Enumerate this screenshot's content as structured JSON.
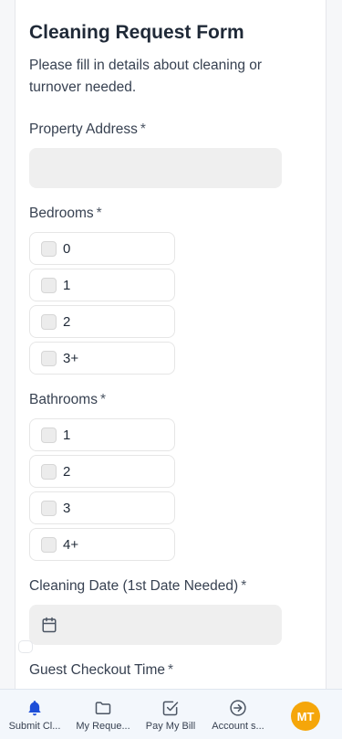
{
  "form": {
    "title": "Cleaning Request Form",
    "description": "Please fill in details about cleaning or turnover needed.",
    "required_marker": "*",
    "property_address": {
      "label": "Property Address",
      "value": ""
    },
    "bedrooms": {
      "label": "Bedrooms",
      "options": [
        "0",
        "1",
        "2",
        "3+"
      ]
    },
    "bathrooms": {
      "label": "Bathrooms",
      "options": [
        "1",
        "2",
        "3",
        "4+"
      ]
    },
    "cleaning_date": {
      "label": "Cleaning Date (1st Date Needed)",
      "value": ""
    },
    "guest_checkout": {
      "label": "Guest Checkout Time"
    }
  },
  "bottom_nav": {
    "items": [
      {
        "label": "Submit Cl...",
        "icon": "bell-icon",
        "active": true
      },
      {
        "label": "My Reque...",
        "icon": "folder-icon"
      },
      {
        "label": "Pay My Bill",
        "icon": "checkbox-icon"
      },
      {
        "label": "Account s...",
        "icon": "sign-in-icon"
      }
    ],
    "avatar_initials": "MT"
  },
  "colors": {
    "accent": "#1d4ed8",
    "avatar": "#f5a60a",
    "input_fill": "#efefef"
  }
}
